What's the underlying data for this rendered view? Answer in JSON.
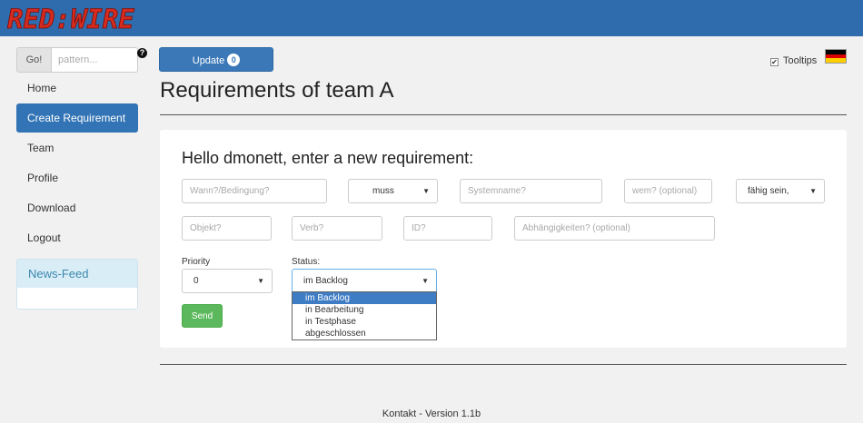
{
  "app": {
    "logo_text": "RED:WIRE",
    "logo_color": "#d62b1f"
  },
  "sidebar": {
    "go_label": "Go!",
    "search_placeholder": "pattern...",
    "help_glyph": "?",
    "items": [
      {
        "label": "Home",
        "active": false
      },
      {
        "label": "Create Requirement",
        "active": true
      },
      {
        "label": "Team",
        "active": false
      },
      {
        "label": "Profile",
        "active": false
      },
      {
        "label": "Download",
        "active": false
      },
      {
        "label": "Logout",
        "active": false
      }
    ],
    "news_feed_label": "News-Feed"
  },
  "header": {
    "update_label": "Update",
    "update_count": "0",
    "tooltips_label": "Tooltips",
    "tooltips_checked_glyph": "✔",
    "flag_colors": [
      "#000000",
      "#dd0000",
      "#ffce00"
    ],
    "page_title": "Requirements of team A"
  },
  "form": {
    "title": "Hello dmonett, enter a new requirement:",
    "row1": {
      "condition_placeholder": "Wann?/Bedingung?",
      "modal_value": "muss",
      "system_placeholder": "Systemname?",
      "whom_placeholder": "wem? (optional)",
      "ability_value": "fähig sein,"
    },
    "row2": {
      "object_placeholder": "Objekt?",
      "verb_placeholder": "Verb?",
      "id_placeholder": "ID?",
      "dependencies_placeholder": "Abhängigkeiten? (optional)"
    },
    "priority_label": "Priority",
    "priority_value": "0",
    "status_label": "Status:",
    "status_value": "im Backlog",
    "status_options": [
      "im Backlog",
      "in Bearbeitung",
      "in Testphase",
      "abgeschlossen"
    ],
    "send_label": "Send"
  },
  "footer": {
    "text": "Kontakt - Version 1.1b"
  },
  "colors": {
    "topbar": "#2f6cad",
    "primary": "#3274b5",
    "success": "#5cb85c"
  }
}
